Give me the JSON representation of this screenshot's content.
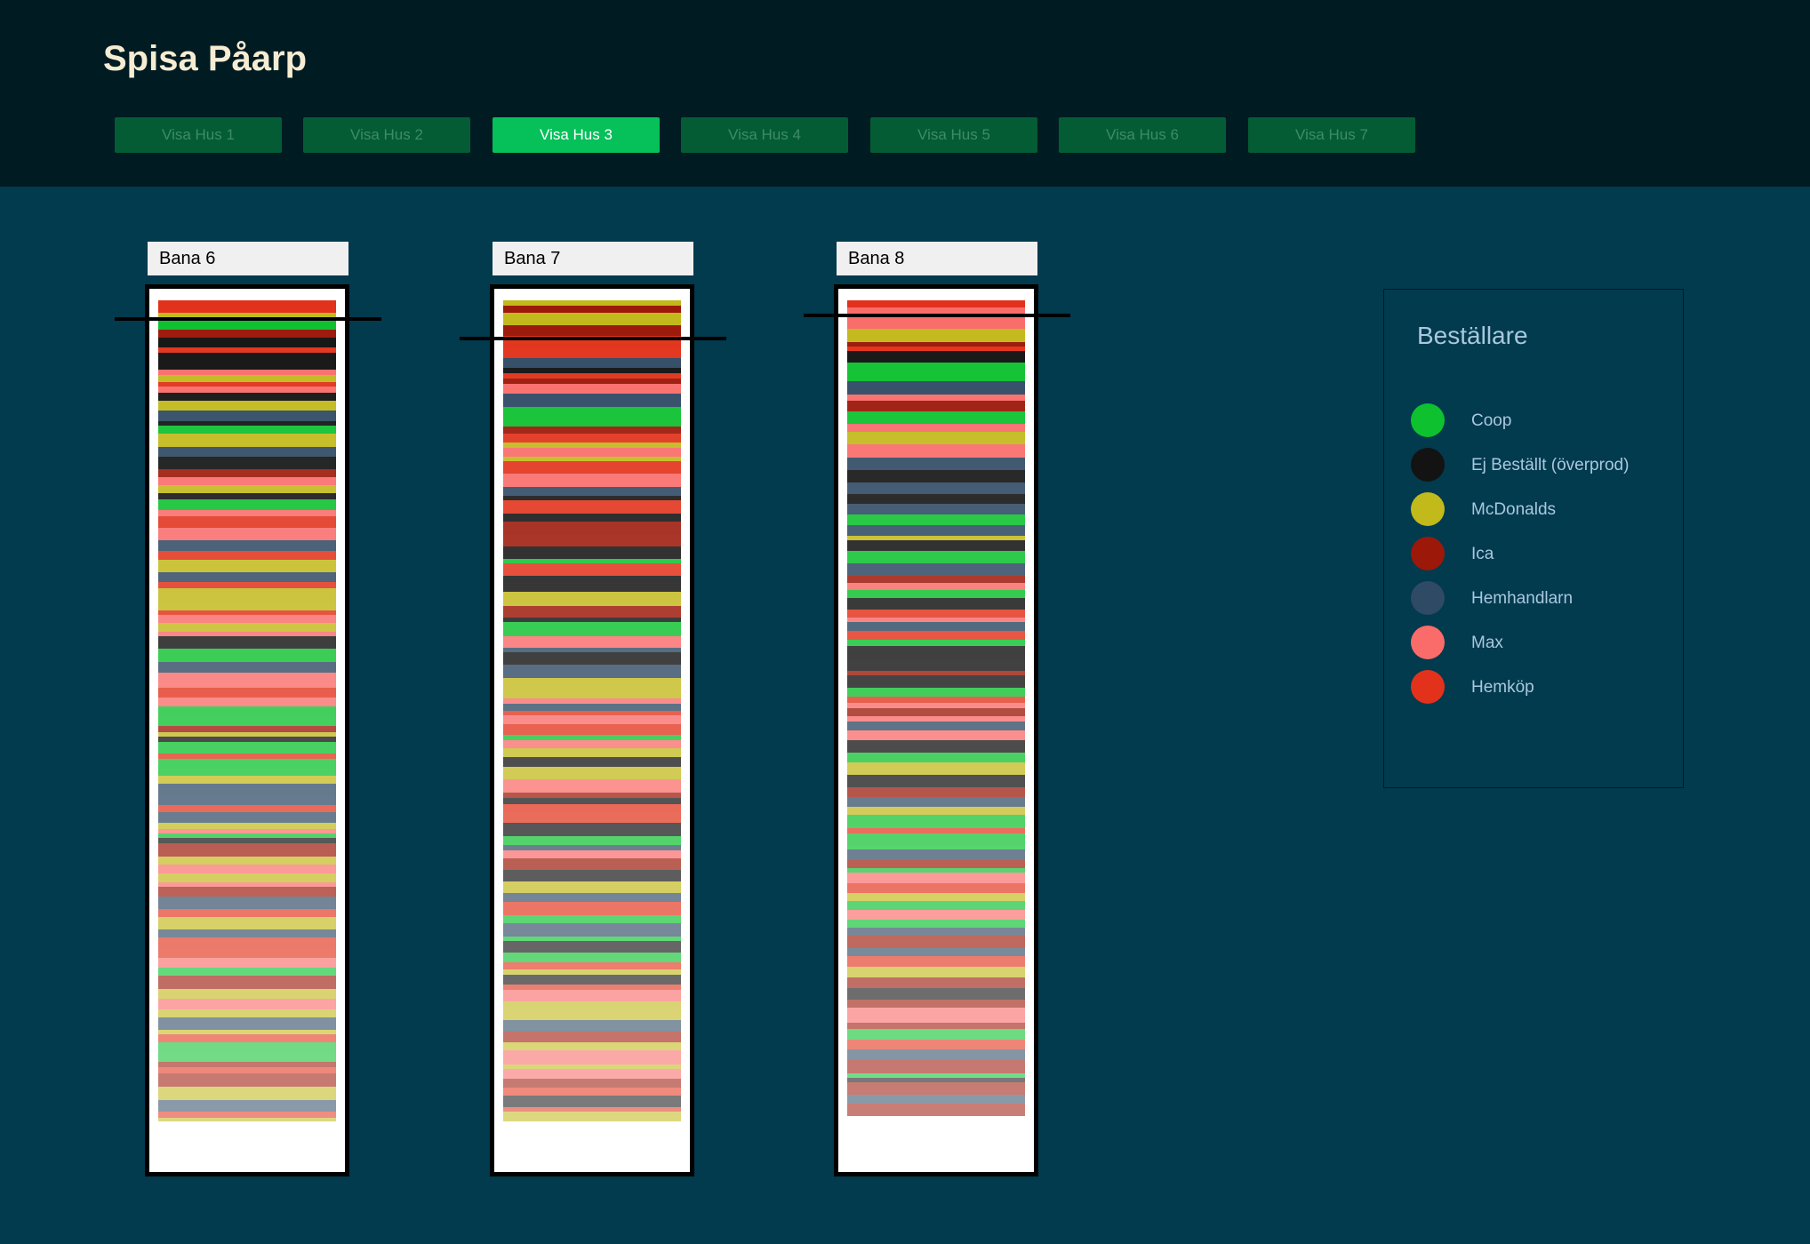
{
  "app": {
    "title": "Spisa Påarp"
  },
  "tabs": [
    {
      "label": "Visa Hus 1",
      "active": false
    },
    {
      "label": "Visa Hus 2",
      "active": false
    },
    {
      "label": "Visa Hus 3",
      "active": true
    },
    {
      "label": "Visa Hus 4",
      "active": false
    },
    {
      "label": "Visa Hus 5",
      "active": false
    },
    {
      "label": "Visa Hus 6",
      "active": false
    },
    {
      "label": "Visa Hus 7",
      "active": false
    }
  ],
  "lanes": [
    {
      "label": "Bana 6",
      "fill_level": 0.955,
      "marker_level": 0.02
    },
    {
      "label": "Bana 7",
      "fill_level": 0.955,
      "marker_level": 0.042
    },
    {
      "label": "Bana 8",
      "fill_level": 0.948,
      "marker_level": 0.016
    }
  ],
  "legend": {
    "title": "Beställare",
    "items": [
      {
        "label": "Coop",
        "color": "#0dc12f"
      },
      {
        "label": "Ej Beställt (överprod)",
        "color": "#131313"
      },
      {
        "label": "McDonalds",
        "color": "#c2b91b"
      },
      {
        "label": "Ica",
        "color": "#9c1809"
      },
      {
        "label": "Hemhandlarn",
        "color": "#2f4a64"
      },
      {
        "label": "Max",
        "color": "#f96c6a"
      },
      {
        "label": "Hemköp",
        "color": "#e2321b"
      }
    ]
  }
}
